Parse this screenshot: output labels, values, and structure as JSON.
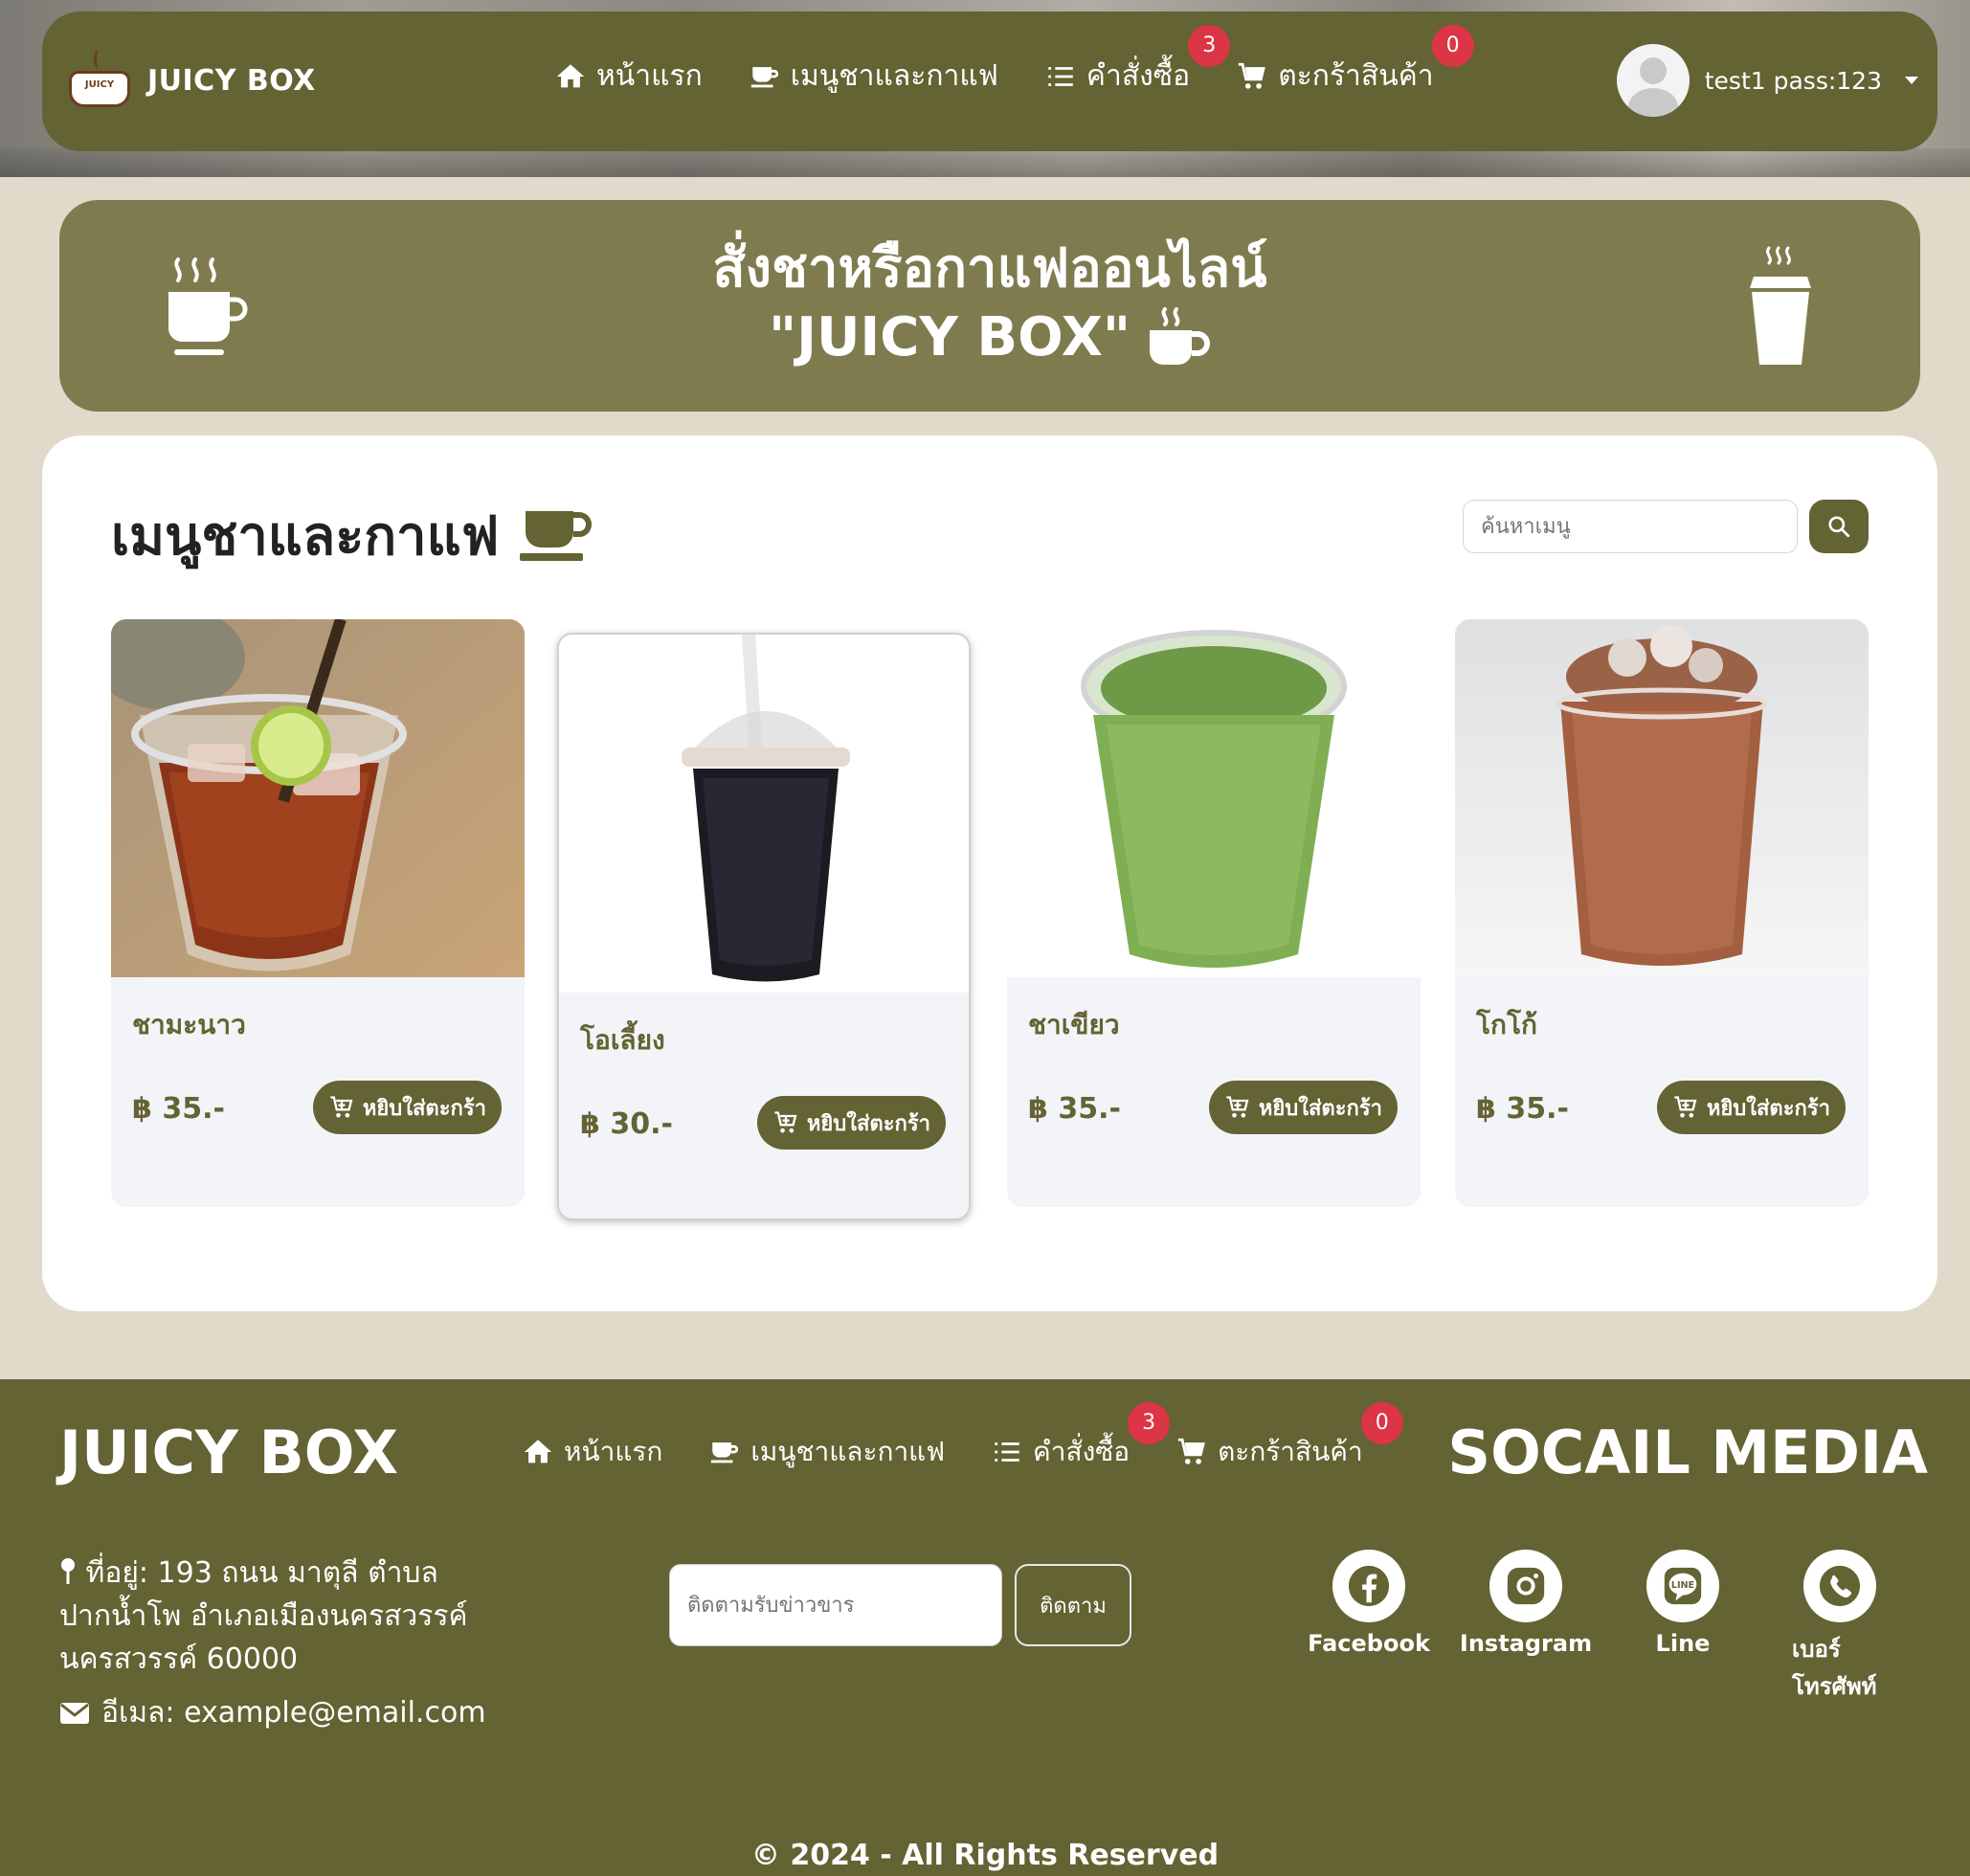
{
  "brand": {
    "name": "JUICY BOX",
    "logo_text": "JUICY"
  },
  "nav": {
    "items": [
      {
        "label": "หน้าแรก",
        "icon": "home-icon"
      },
      {
        "label": "เมนูชาและกาแฟ",
        "icon": "mug-icon"
      },
      {
        "label": "คำสั่งซื้อ",
        "icon": "list-icon",
        "badge": "3"
      },
      {
        "label": "ตะกร้าสินค้า",
        "icon": "cart-icon",
        "badge": "0"
      }
    ]
  },
  "user": {
    "name": "test1 pass:123"
  },
  "banner": {
    "line1": "สั่งชาหรือกาแฟออนไลน์",
    "line2": "\"JUICY BOX\""
  },
  "menu": {
    "title": "เมนูชาและกาแฟ",
    "search_placeholder": "ค้นหาเมนู",
    "add_label": "หยิบใส่ตะกร้า",
    "items": [
      {
        "name": "ชามะนาว",
        "price": "฿ 35.-"
      },
      {
        "name": "โอเลี้ยง",
        "price": "฿ 30.-"
      },
      {
        "name": "ชาเขียว",
        "price": "฿ 35.-"
      },
      {
        "name": "โกโก้",
        "price": "฿ 35.-"
      }
    ]
  },
  "footer": {
    "brand": "JUICY BOX",
    "social_title": "SOCAIL MEDIA",
    "address": "ที่อยู่: 193 ถนน มาตุลี ตำบล ปากน้ำโพ อำเภอเมืองนครสวรรค์ นครสวรรค์ 60000",
    "email": "อีเมล: example@email.com",
    "subscribe_placeholder": "ติดตามรับข่าวขาร",
    "subscribe_button": "ติดตาม",
    "socials": [
      "Facebook",
      "Instagram",
      "Line",
      "เบอร์โทรศัพท์"
    ],
    "copyright": "© 2024 - All Rights Reserved"
  },
  "colors": {
    "primary": "#636333",
    "banner": "#7e7c4e",
    "page_bg": "#e1d9c9",
    "badge": "#dc3545",
    "card_bg": "#f2f4f8"
  }
}
